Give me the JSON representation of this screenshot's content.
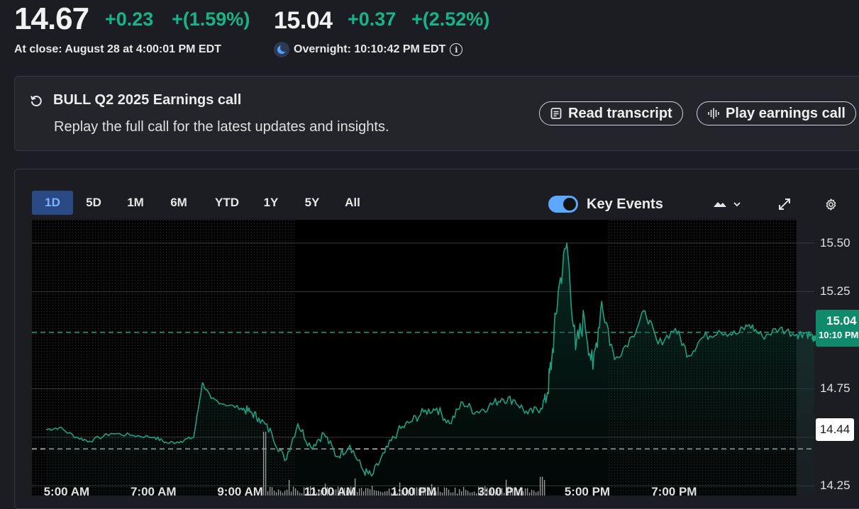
{
  "quote": {
    "close_price": "14.67",
    "close_change": "+0.23",
    "close_change_pct": "+(1.59%)",
    "post_price": "15.04",
    "post_change": "+0.37",
    "post_change_pct": "+(2.52%)",
    "close_label": "At close: August 28 at 4:00:01 PM EDT",
    "overnight_label": "Overnight: 10:10:42 PM EDT"
  },
  "earnings": {
    "title": "BULL Q2 2025 Earnings call",
    "description": "Replay the full call for the latest updates and insights.",
    "read_transcript": "Read transcript",
    "play_call": "Play earnings call"
  },
  "chart_controls": {
    "ranges": [
      "1D",
      "5D",
      "1M",
      "6M",
      "YTD",
      "1Y",
      "5Y",
      "All"
    ],
    "active_range": "1D",
    "key_events_label": "Key Events",
    "key_events_on": true
  },
  "price_tags": {
    "current_price": "15.04",
    "current_time": "10:10 PM",
    "prev_close": "14.44"
  },
  "colors": {
    "up_green": "#17b38b",
    "line": "#1f9f80",
    "accent_blue": "#5ca8ff",
    "tag_bg": "#0f8a6b"
  },
  "chart_data": {
    "type": "line",
    "y_ticks": [
      "15.50",
      "15.25",
      "14.75",
      "14.50",
      "14.25"
    ],
    "x_ticks": [
      "5:00 AM",
      "7:00 AM",
      "9:00 AM",
      "11:00 AM",
      "1:00 PM",
      "3:00 PM",
      "5:00 PM",
      "7:00 PM"
    ],
    "ylim": [
      14.2,
      15.62
    ],
    "x_range_hours": [
      4.5,
      22.2
    ],
    "reference_lines": {
      "previous_close": 14.44,
      "current": 15.04
    },
    "series": [
      {
        "x": [
          4.5,
          4.8,
          5.2,
          5.5,
          6.0,
          6.5,
          7.0,
          7.3,
          7.6,
          7.9,
          8.1,
          8.3,
          8.6,
          9.0,
          9.2,
          9.4,
          9.7,
          10.0,
          10.3,
          10.6,
          10.9,
          11.2,
          11.5,
          11.8,
          12.0,
          12.3,
          12.6,
          12.9,
          13.2,
          13.5,
          13.8,
          14.1,
          14.4,
          14.7,
          15.0,
          15.3,
          15.6,
          15.9,
          16.05,
          16.15,
          16.3,
          16.5,
          16.7,
          16.9,
          17.1,
          17.3,
          17.6,
          18.0,
          18.3,
          18.6,
          19.0,
          19.3,
          19.6,
          20.0,
          20.4,
          20.7,
          21.0,
          21.4,
          21.8,
          22.0,
          22.2
        ],
        "y": [
          14.54,
          14.55,
          14.5,
          14.48,
          14.52,
          14.51,
          14.5,
          14.47,
          14.48,
          14.5,
          14.78,
          14.7,
          14.67,
          14.65,
          14.63,
          14.6,
          14.52,
          14.38,
          14.57,
          14.45,
          14.52,
          14.4,
          14.46,
          14.33,
          14.3,
          14.42,
          14.53,
          14.58,
          14.63,
          14.65,
          14.57,
          14.68,
          14.63,
          14.66,
          14.7,
          14.69,
          14.62,
          14.65,
          14.73,
          14.9,
          15.25,
          15.5,
          14.95,
          15.12,
          14.85,
          15.2,
          14.9,
          15.02,
          15.15,
          14.98,
          15.06,
          14.92,
          15.01,
          15.05,
          15.03,
          15.08,
          15.02,
          15.06,
          15.03,
          15.04,
          15.01
        ]
      }
    ]
  }
}
